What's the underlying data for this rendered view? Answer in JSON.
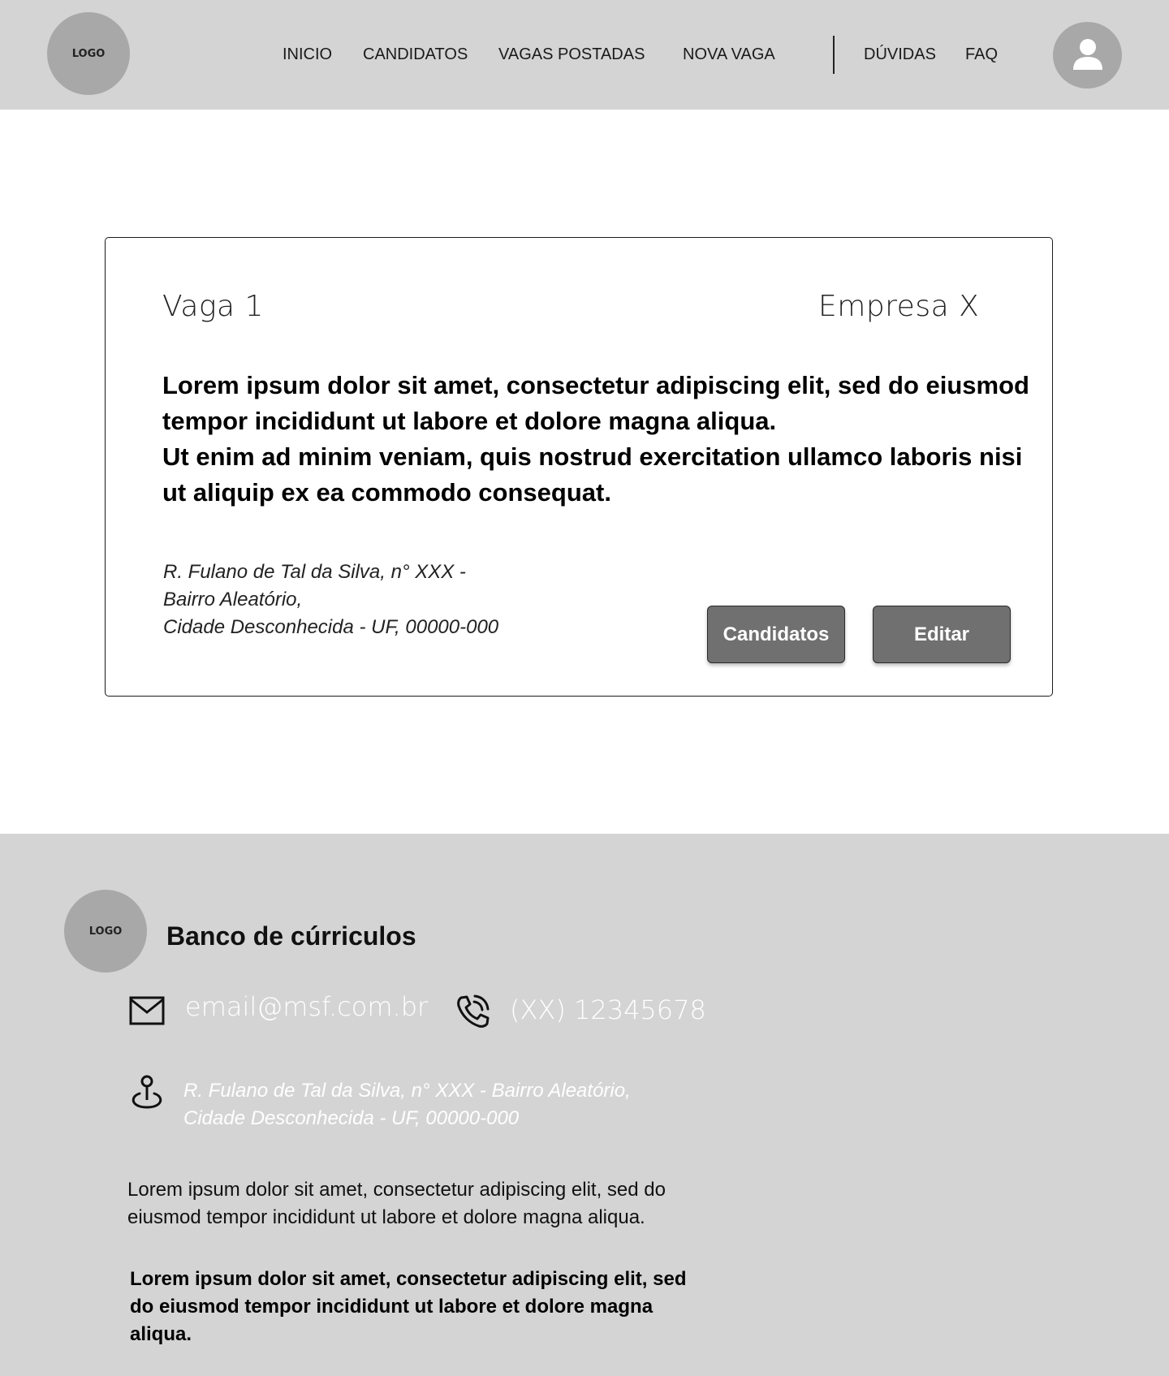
{
  "header": {
    "logo": "LOGO",
    "nav": {
      "inicio": "INICIO",
      "candidatos": "CANDIDATOS",
      "vagas_postadas": "VAGAS POSTADAS",
      "nova_vaga": "NOVA VAGA",
      "duvidas": "DÚVIDAS",
      "faq": "FAQ"
    },
    "avatar_icon": "user-icon"
  },
  "job": {
    "title": "Vaga 1",
    "company": "Empresa X",
    "description_1": "Lorem ipsum dolor sit amet, consectetur adipiscing elit, sed do eiusmod tempor incididunt ut labore et dolore magna aliqua.",
    "description_2": "Ut enim ad minim veniam, quis nostrud exercitation ullamco laboris nisi ut aliquip ex ea commodo consequat.",
    "address_line_1": "R. Fulano de Tal da Silva, n° XXX -",
    "address_line_2": "Bairro Aleatório,",
    "address_line_3": "Cidade Desconhecida - UF, 00000-000",
    "candidatos_button": "Candidatos",
    "editar_button": "Editar"
  },
  "footer": {
    "logo": "LOGO",
    "brand": "Banco de cúrriculos",
    "email": "email@msf.com.br",
    "phone": "(XX) 12345678",
    "address_line_1": "R. Fulano de Tal da Silva, n° XXX - Bairro Aleatório,",
    "address_line_2": "Cidade Desconhecida - UF, 00000-000",
    "text_1": "Lorem ipsum dolor sit amet, consectetur adipiscing elit, sed do eiusmod tempor incididunt ut labore et dolore magna aliqua.",
    "text_2": "Lorem ipsum dolor sit amet, consectetur adipiscing elit, sed do eiusmod tempor incididunt ut labore et dolore magna aliqua.",
    "icons": [
      "email-icon",
      "phone-icon",
      "location-pin-icon"
    ]
  },
  "colors": {
    "header_bg": "#d4d4d4",
    "footer_bg": "#d4d4d4",
    "logo_bg": "#a8a8a8",
    "button_bg": "#707070",
    "footer_contact_text": "#ffffff"
  }
}
